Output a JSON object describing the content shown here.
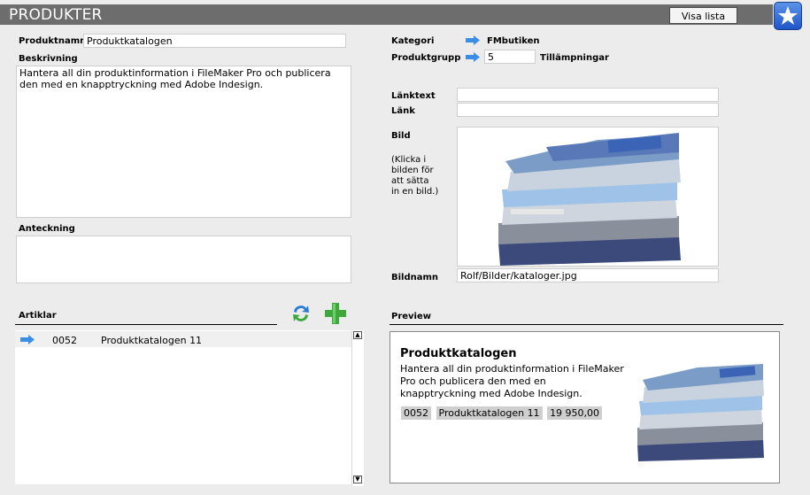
{
  "header": {
    "title": "PRODUKTER",
    "visa_lista": "Visa lista"
  },
  "left": {
    "produktnamn_label": "Produktnamn",
    "produktnamn_value": "Produktkatalogen",
    "beskrivning_label": "Beskrivning",
    "beskrivning_value": "Hantera all din produktinformation i FileMaker Pro och publicera den med en knapptryckning med Adobe Indesign.",
    "anteckning_label": "Anteckning",
    "anteckning_value": "",
    "artiklar_label": "Artiklar",
    "articles": [
      {
        "nr": "0052",
        "name": "Produktkatalogen 11"
      }
    ]
  },
  "right": {
    "kategori_label": "Kategori",
    "kategori_value": "FMbutiken",
    "produktgrupp_label": "Produktgrupp",
    "produktgrupp_value": "5",
    "produktgrupp_name": "Tillämpningar",
    "lanktext_label": "Länktext",
    "lanktext_value": "",
    "lank_label": "Länk",
    "lank_value": "",
    "bild_label": "Bild",
    "bild_hint": [
      "(Klicka i",
      "bilden för",
      "att sätta",
      "in en bild.)"
    ],
    "bildnamn_label": "Bildnamn",
    "bildnamn_value": "Rolf/Bilder/kataloger.jpg"
  },
  "preview": {
    "label": "Preview",
    "title": "Produktkatalogen",
    "text_lines": [
      "Hantera all din produktinformation i FileMaker",
      "Pro och publicera den med en",
      "knapptryckning med Adobe Indesign."
    ],
    "chips": [
      "0052",
      "Produktkatalogen 11",
      "19 950,00"
    ]
  },
  "icons": {
    "arrow_color": "#3b8ee6",
    "refresh_icon": "refresh-icon",
    "add_icon": "plus-icon",
    "star_icon": "star-icon"
  }
}
